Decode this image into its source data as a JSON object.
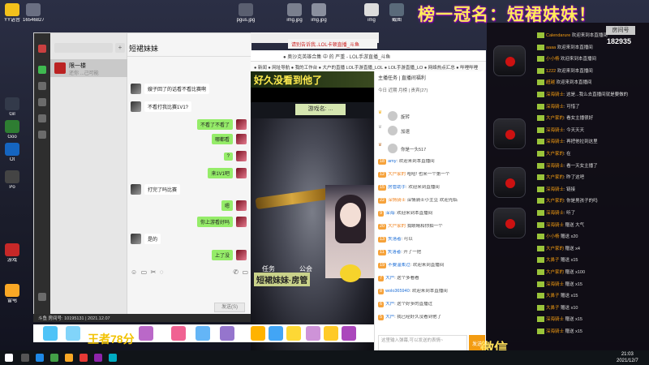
{
  "banner": {
    "text": "榜一冠名：短裙妹妹！"
  },
  "desktop": {
    "icons": [
      {
        "label": "YY语音",
        "color": "#f3c11b"
      },
      {
        "label": "165468276...",
        "color": "#6a6f82"
      },
      {
        "label": "Gil",
        "color": "#333a4a"
      },
      {
        "label": "Goo",
        "color": "#2e7d32"
      },
      {
        "label": "Ot",
        "color": "#1565c0"
      },
      {
        "label": "Po",
        "color": "#444"
      },
      {
        "label": "游戏",
        "color": "#c62828"
      },
      {
        "label": "雷电",
        "color": "#f9a825"
      }
    ],
    "top_icons": [
      "pgus.jpg",
      "img.jpg",
      "img.jpg",
      "img",
      "截图"
    ]
  },
  "chat_window": {
    "search_placeholder": "",
    "contact_name": "限一楼",
    "contact_sub": "还你 ...己可能",
    "title": "短裙妹妹",
    "messages": [
      {
        "side": "left",
        "text": "嫂子回了的话看不看比赛啊"
      },
      {
        "side": "left",
        "text": "不看打我比赛1V1?"
      },
      {
        "side": "right",
        "text": "不看了不看了"
      },
      {
        "side": "right",
        "text": "哪都看"
      },
      {
        "side": "right",
        "text": "?"
      },
      {
        "side": "right",
        "text": "来1V1吧"
      },
      {
        "side": "left",
        "text": "打完了吗比赛"
      },
      {
        "side": "right",
        "text": "嗯"
      },
      {
        "side": "right",
        "text": "你上游看好吗"
      },
      {
        "side": "left",
        "text": "是的"
      },
      {
        "side": "right",
        "text": "上了没"
      }
    ],
    "send_label": "发送(S)",
    "footer": "斗鱼 房间号: 10195131 | 2021.12.07"
  },
  "stream": {
    "tab_title": "请别告诉我..LOL卡顿直播_斗鱼",
    "address": "● 奥沙克英雄合集 中 的 严重 - LOL手游直播_斗鱼",
    "bookmarks": "● 新闻 ● 网址导航 ● 我的工作台 ● 大户的直播 LOL手游直播_LOL ● LOL手游直播_LO ● 网络热点汇总 ● 哔哩哔哩",
    "video_top_text": "好久没看到他了",
    "gamer_tag": "游戏名: ...",
    "video_label_a": "任务",
    "video_label_b": "公会",
    "video_bottom_text": "短裙妹妹·房管"
  },
  "stream_panel": {
    "tabs": "主播任务 | 直播间福利",
    "rank_tabs": "今日 近期 月榜 | 贵宾(27)",
    "ranks": [
      {
        "name": "旋转"
      },
      {
        "name": "加速"
      },
      {
        "name": "你是一头517"
      }
    ],
    "chat": [
      {
        "lv": "18",
        "name": "amy",
        "text": ": 欢迎来到本直播间",
        "sys": false
      },
      {
        "lv": "12",
        "name": "大户家的",
        "text": " 哈哈! 也来一个第一个",
        "sys": true
      },
      {
        "lv": "15",
        "name": "房管助手",
        "text": ": 欢迎来到直播间",
        "sys": false
      },
      {
        "lv": "22",
        "name": "深情骑士",
        "text": " 深情骑士小主豆 欢迎光临",
        "sys": true
      },
      {
        "lv": "9",
        "name": "深海",
        "text": ": 欢迎来到本直播间",
        "sys": false
      },
      {
        "lv": "20",
        "name": "大户家的",
        "text": " 我眼睛和你拍一个",
        "sys": true
      },
      {
        "lv": "13",
        "name": "失落者",
        "text": ": 可以",
        "sys": false
      },
      {
        "lv": "11",
        "name": "失落者",
        "text": ": 开了一把",
        "sys": false
      },
      {
        "lv": "19",
        "name": "不要温柔过",
        "text": ": 欢迎来到直播间",
        "sys": false
      },
      {
        "lv": "7",
        "name": "大户",
        "text": ": 这个多看看",
        "sys": false
      },
      {
        "lv": "8",
        "name": "wolo365940",
        "text": ": 欢迎来到本直播间",
        "sys": false
      },
      {
        "lv": "6",
        "name": "大户",
        "text": ": 这个好多的直播过",
        "sys": false
      },
      {
        "lv": "5",
        "name": "大户",
        "text": ": 我已经好久没看到他了",
        "sys": false
      }
    ],
    "input_placeholder": "这里输入弹幕,可以发送的表情~",
    "send_label": "发送"
  },
  "gift_strip": {
    "king_text": "王者78分"
  },
  "weixin": "微信",
  "right_panel": {
    "counter_title": "房间号",
    "counter_value": "182935",
    "lines": [
      {
        "name": "Calendarure",
        "text": " 欢迎来到本直播间"
      },
      {
        "name": "aaaa",
        "text": " 欢迎来到本直播间"
      },
      {
        "name": "小小杨",
        "text": " 欢迎来到本直播间"
      },
      {
        "name": "1222",
        "text": " 欢迎来到本直播间"
      },
      {
        "name": "超越",
        "text": " 欢迎来到本直播间"
      },
      {
        "name": "深海骑士",
        "text": ": 这是...我么去直播间就是要做的"
      },
      {
        "name": "深海骑士",
        "text": ": 可惜了"
      },
      {
        "name": "大户家的",
        "text": ": 看女主播很好"
      },
      {
        "name": "深海骑士",
        "text": ": 今天天天"
      },
      {
        "name": "深海骑士",
        "text": ": 再把他拉到这里"
      },
      {
        "name": "大户家的",
        "text": ": 在"
      },
      {
        "name": "深海骑士",
        "text": ": 看一天女主播了"
      },
      {
        "name": "大户家的",
        "text": ": 昨了这吧"
      },
      {
        "name": "深海骑士",
        "text": ": 链接"
      },
      {
        "name": "大户家的",
        "text": ": 你是男孩子的吗"
      },
      {
        "name": "深海骑士",
        "text": ": 听了"
      },
      {
        "name": "深海骑士",
        "text": " 赠送 大气"
      },
      {
        "name": "小小杨",
        "text": " 赠送 x20"
      },
      {
        "name": "大户家的",
        "text": " 赠送 x4"
      },
      {
        "name": "大鼻子",
        "text": " 赠送 x15"
      },
      {
        "name": "大户家的",
        "text": " 赠送 x100"
      },
      {
        "name": "深海骑士",
        "text": " 赠送 x15"
      },
      {
        "name": "大鼻子",
        "text": " 赠送 x15"
      },
      {
        "name": "大鼻子",
        "text": " 赠送 x10"
      },
      {
        "name": "深海骑士",
        "text": " 赠送 x15"
      },
      {
        "name": "深海骑士",
        "text": " 赠送 x15"
      }
    ]
  },
  "taskbar": {
    "time": "21:03",
    "date": "2021/12/7"
  }
}
